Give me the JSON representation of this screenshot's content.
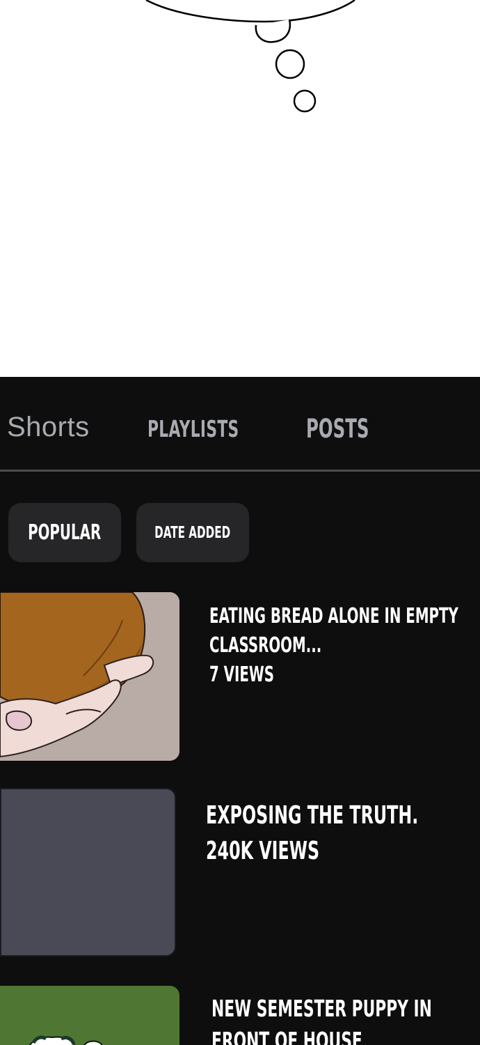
{
  "tabs": [
    {
      "label": "Shorts"
    },
    {
      "label": "PLAYLISTS"
    },
    {
      "label": "POSTS"
    }
  ],
  "filters": {
    "popular": "POPULAR",
    "date_added": "DATE ADDED"
  },
  "videos": [
    {
      "title_line1": "EATING BREAD ALONE IN EMPTY",
      "title_line2": "CLASSROOM...",
      "views": "7 VIEWS"
    },
    {
      "title_line1": "EXPOSING THE TRUTH.",
      "views": "240K VIEWS"
    },
    {
      "title_line1": "NEW SEMESTER PUPPY IN",
      "title_line2": "FRONT OF HOUSE"
    }
  ],
  "colors": {
    "background": "#0e0e0f",
    "chip": "#262628",
    "tab_text": "#a9abb1",
    "divider": "#4a4c52"
  }
}
